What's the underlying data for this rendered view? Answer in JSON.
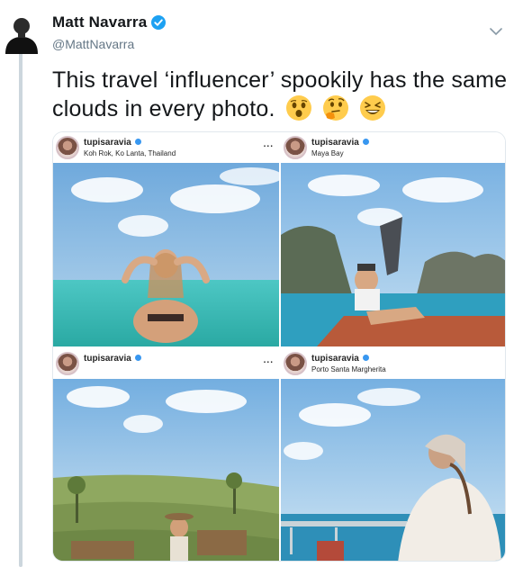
{
  "tweet": {
    "author_name": "Matt Navarra",
    "author_handle": "@MattNavarra",
    "text": "This travel ‘influencer’ spookily has the same clouds in every photo.",
    "emojis": [
      "hushed-face-emoji",
      "thinking-face-emoji",
      "grinning-squinting-face-emoji"
    ],
    "verified_color": "#1da1f2"
  },
  "media": {
    "panels": [
      {
        "username": "tupisaravia",
        "location": "Koh Rok, Ko Lanta, Thailand",
        "more": "..."
      },
      {
        "username": "tupisaravia",
        "location": "Maya Bay",
        "more": ""
      },
      {
        "username": "tupisaravia",
        "location": "",
        "more": "..."
      },
      {
        "username": "tupisaravia",
        "location": "Porto Santa Margherita",
        "more": ""
      }
    ]
  }
}
